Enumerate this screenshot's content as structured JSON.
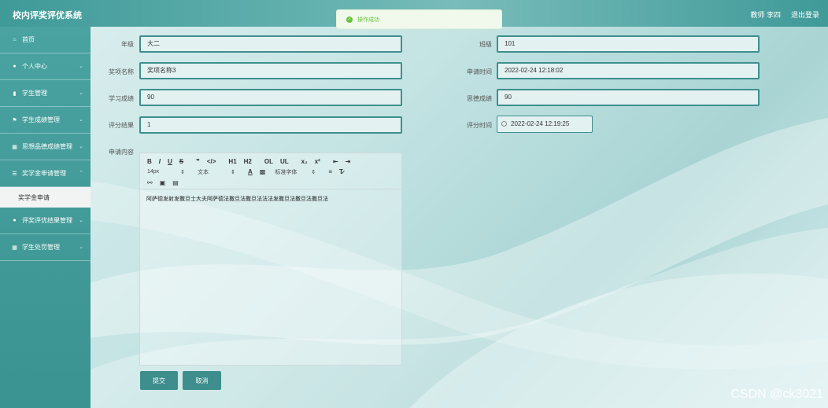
{
  "header": {
    "app_title": "校内评奖评优系统",
    "user": "教师 李四",
    "logout": "退出登录"
  },
  "toast": {
    "icon": "check-circle-icon",
    "message": "操作成功",
    "color": "#67c23a"
  },
  "sidebar": {
    "items": [
      {
        "icon": "home-icon",
        "label": "首页"
      },
      {
        "icon": "user-icon",
        "label": "个人中心"
      },
      {
        "icon": "clipboard-icon",
        "label": "学生管理"
      },
      {
        "icon": "flag-icon",
        "label": "学生成绩管理"
      },
      {
        "icon": "grid-icon",
        "label": "思想品德成绩管理"
      },
      {
        "icon": "list-icon",
        "label": "奖学金申请管理"
      },
      {
        "icon": "location-icon",
        "label": "评奖评优结果管理"
      },
      {
        "icon": "grid-icon",
        "label": "学生处罚管理"
      }
    ],
    "sub_item": "奖学金申请"
  },
  "form": {
    "grade_label": "年级",
    "grade_value": "大二",
    "class_label": "班级",
    "class_value": "101",
    "award_name_label": "奖项名称",
    "award_name_value": "奖项名称3",
    "apply_time_label": "申请时间",
    "apply_time_value": "2022-02-24 12:18:02",
    "study_score_label": "学习成绩",
    "study_score_value": "90",
    "ideology_score_label": "思德成绩",
    "ideology_score_value": "90",
    "eval_result_label": "评分结果",
    "eval_result_value": "1",
    "eval_time_label": "评分时间",
    "eval_time_value": "2022-02-24 12:19:25",
    "content_label": "申请内容"
  },
  "editor": {
    "row1": [
      "B",
      "I",
      "U",
      "S",
      "❞",
      "</>",
      "H1",
      "H2",
      "OL",
      "UL",
      "x₂",
      "x²",
      "⇤",
      "⇥"
    ],
    "font_size": "14px",
    "text_type": "文本",
    "font_family": "标准字体",
    "content": "阿萨德发射发撒旦士大夫阿萨德法撒旦法撒旦法法法发撒旦法撒旦法撒旦法"
  },
  "buttons": {
    "submit": "提交",
    "cancel": "取消"
  },
  "watermark": "CSDN @ck3021",
  "colors": {
    "accent": "#3d8e8c",
    "sidebar": "#4aa3a1"
  }
}
